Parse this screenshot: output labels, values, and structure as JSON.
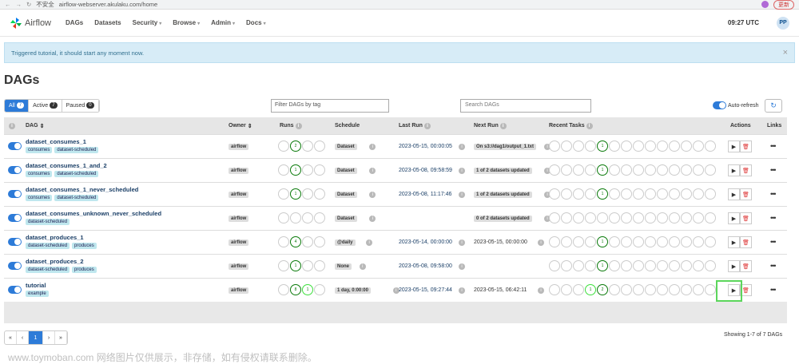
{
  "browser": {
    "security_label": "不安全",
    "url": "airflow-webserver.akulaku.com/home",
    "update_label": "更新"
  },
  "navbar": {
    "brand": "Airflow",
    "menu": [
      "DAGs",
      "Datasets",
      "Security",
      "Browse",
      "Admin",
      "Docs"
    ],
    "time": "09:27 UTC",
    "user_initials": "PP"
  },
  "alert": {
    "message": "Triggered tutorial, it should start any moment now.",
    "close": "×"
  },
  "page_title": "DAGs",
  "filters": {
    "all_label": "All",
    "all_count": "7",
    "active_label": "Active",
    "active_count": "7",
    "paused_label": "Paused",
    "paused_count": "0",
    "tag_placeholder": "Filter DAGs by tag",
    "search_placeholder": "Search DAGs",
    "auto_refresh": "Auto-refresh"
  },
  "columns": {
    "dag": "DAG",
    "owner": "Owner",
    "runs": "Runs",
    "schedule": "Schedule",
    "last_run": "Last Run",
    "next_run": "Next Run",
    "recent_tasks": "Recent Tasks",
    "actions": "Actions",
    "links": "Links"
  },
  "rows": [
    {
      "name": "dataset_consumes_1",
      "tags": [
        "consumes",
        "dataset-scheduled"
      ],
      "owner": "airflow",
      "run_counts": [
        "",
        "2",
        "",
        ""
      ],
      "schedule": "Dataset",
      "last_run": "2023-05-15, 00:00:05",
      "next_run": "On s3://dag1/output_1.txt",
      "next_is_tag": true,
      "task_count": "1"
    },
    {
      "name": "dataset_consumes_1_and_2",
      "tags": [
        "consumes",
        "dataset-scheduled"
      ],
      "owner": "airflow",
      "run_counts": [
        "",
        "1",
        "",
        ""
      ],
      "schedule": "Dataset",
      "last_run": "2023-05-08, 09:58:59",
      "next_run": "1 of 2 datasets updated",
      "next_is_tag": true,
      "task_count": "1"
    },
    {
      "name": "dataset_consumes_1_never_scheduled",
      "tags": [
        "consumes",
        "dataset-scheduled"
      ],
      "owner": "airflow",
      "run_counts": [
        "",
        "1",
        "",
        ""
      ],
      "schedule": "Dataset",
      "last_run": "2023-05-08, 11:17:46",
      "next_run": "1 of 2 datasets updated",
      "next_is_tag": true,
      "task_count": "1"
    },
    {
      "name": "dataset_consumes_unknown_never_scheduled",
      "tags": [
        "dataset-scheduled"
      ],
      "owner": "airflow",
      "run_counts": [
        "",
        "",
        "",
        ""
      ],
      "schedule": "Dataset",
      "last_run": "",
      "next_run": "0 of 2 datasets updated",
      "next_is_tag": true,
      "task_count": ""
    },
    {
      "name": "dataset_produces_1",
      "tags": [
        "dataset-scheduled",
        "produces"
      ],
      "owner": "airflow",
      "run_counts": [
        "",
        "4",
        "",
        ""
      ],
      "schedule": "@daily",
      "last_run": "2023-05-14, 00:00:00",
      "next_run": "2023-05-15, 00:00:00",
      "next_is_tag": false,
      "task_count": "1"
    },
    {
      "name": "dataset_produces_2",
      "tags": [
        "dataset-scheduled",
        "produces"
      ],
      "owner": "airflow",
      "run_counts": [
        "",
        "1",
        "",
        ""
      ],
      "schedule": "None",
      "last_run": "2023-05-08, 09:58:00",
      "next_run": "",
      "next_is_tag": false,
      "task_count": "1"
    },
    {
      "name": "tutorial",
      "tags": [
        "example"
      ],
      "owner": "airflow",
      "run_counts": [
        "",
        "8",
        "1",
        ""
      ],
      "schedule": "1 day, 0:00:00",
      "last_run": "2023-05-15, 09:27:44",
      "next_run": "2023-05-15, 06:42:11",
      "next_is_tag": false,
      "task_count": "2",
      "task_running": "1"
    }
  ],
  "pagination": {
    "first": "«",
    "prev": "‹",
    "current": "1",
    "next": "›",
    "last": "»"
  },
  "showing": "Showing 1-7 of 7 DAGs",
  "watermark": "www.toymoban.com 网络图片仅供展示，非存储，如有侵权请联系删除。"
}
